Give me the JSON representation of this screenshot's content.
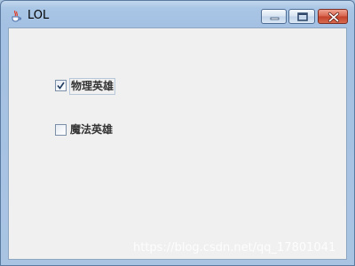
{
  "window": {
    "title": "LOL",
    "app_icon": "java-coffee-cup-icon",
    "controls": {
      "minimize_icon": "minimize-icon",
      "maximize_icon": "maximize-icon",
      "close_icon": "close-icon"
    }
  },
  "checkboxes": [
    {
      "label": "物理英雄",
      "checked": true,
      "focused": true
    },
    {
      "label": "魔法英雄",
      "checked": false,
      "focused": false
    }
  ],
  "watermark": "https://blog.csdn.net/qq_17801041",
  "colors": {
    "titlebar": "#a9c4e3",
    "client_background": "#f0f0f0",
    "close_button": "#c2412a",
    "label_text": "#333333"
  }
}
